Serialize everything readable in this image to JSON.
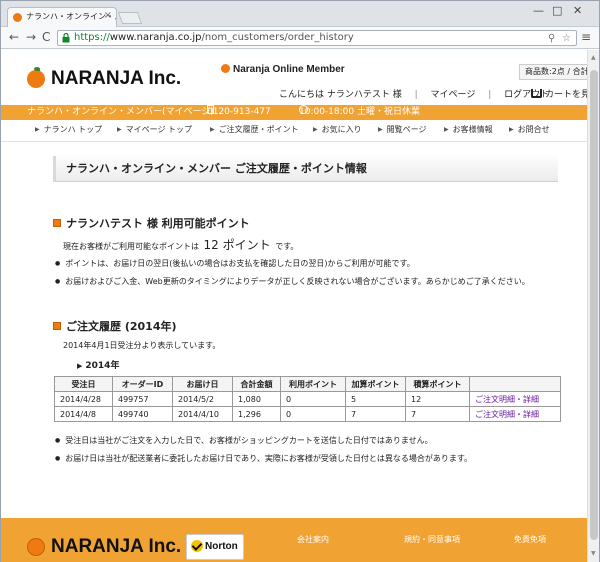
{
  "browser": {
    "tab_title": "ナランハ・オンライン・メンバー",
    "tab_close": "×",
    "win_min": "—",
    "win_max": "□",
    "win_close": "✕",
    "back": "←",
    "forward": "→",
    "reload": "C",
    "url_scheme": "https://",
    "url_host": "www.naranja.co.jp",
    "url_path": "/nom_customers/order_history",
    "zoom_icon": "⚲",
    "star_icon": "☆",
    "menu_icon": "≡"
  },
  "header": {
    "logo_text": "NARANJA Inc.",
    "member_brand": "Naranja Online Member",
    "greeting": "こんにちは ナランハテスト 様",
    "mypage": "マイページ",
    "logout": "ログアウト",
    "cart_count": "商品数:2点 / 合計",
    "cart_label": "カートを見"
  },
  "info_bar": {
    "site_name": "ナランハ・オンライン・メンバー(マイページ)",
    "phone": "0120-913-477",
    "hours": "10:00-18:00 土曜・祝日休業"
  },
  "subnav": [
    "ナランハ トップ",
    "マイページ トップ",
    "ご注文履歴・ポイント",
    "お気に入り",
    "閲覧ページ",
    "お客様情報",
    "お問合せ"
  ],
  "main": {
    "page_title": "ナランハ・オンライン・メンバー ご注文履歴・ポイント情報",
    "points": {
      "heading": "ナランハテスト 様 利用可能ポイント",
      "text_prefix": "現在お客様がご利用可能なポイントは",
      "value": "12 ポイント",
      "text_suffix": "です。",
      "note1": "ポイントは、お届け日の翌日(後払いの場合はお支払を確認した日の翌日)からご利用が可能です。",
      "note2": "お届けおよびご入金、Web更新のタイミングによりデータが正しく反映されない場合がございます。あらかじめご了承ください。"
    },
    "history": {
      "heading": "ご注文履歴 (2014年)",
      "intro": "2014年4月1日受注分より表示しています。",
      "year_label": "2014年",
      "columns": [
        "受注日",
        "オーダーID",
        "お届け日",
        "合計金額",
        "利用ポイント",
        "加算ポイント",
        "積算ポイント",
        ""
      ],
      "rows": [
        [
          "2014/4/28",
          "499757",
          "2014/5/2",
          "1,080",
          "0",
          "5",
          "12",
          "ご注文明細・詳細"
        ],
        [
          "2014/4/8",
          "499740",
          "2014/4/10",
          "1,296",
          "0",
          "7",
          "7",
          "ご注文明細・詳細"
        ]
      ],
      "note1": "受注日は当社がご注文を入力した日で、お客様がショッピングカートを送信した日付ではありません。",
      "note2": "お届け日は当社が配送業者に委託したお届け日であり、実際にお客様が受領した日付とは異なる場合があります。"
    }
  },
  "footer": {
    "logo_text": "NARANJA Inc.",
    "norton": "Norton",
    "links": [
      "会社案内",
      "規約・同意事項",
      "免責免項"
    ]
  }
}
